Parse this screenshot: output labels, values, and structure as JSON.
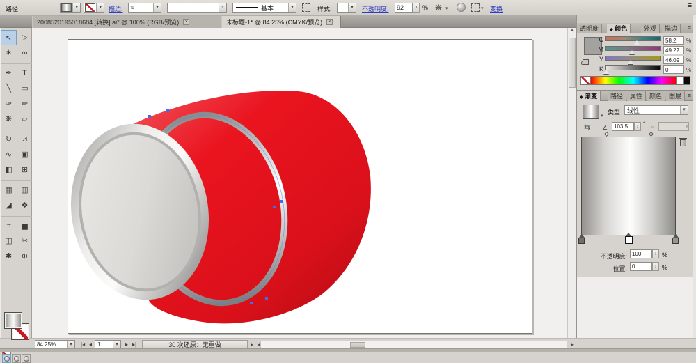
{
  "control_bar": {
    "object_label": "路径",
    "stroke_label": "描边:",
    "brush_value": "基本",
    "style_label": "样式:",
    "opacity_label": "不透明度:",
    "opacity_value": "92",
    "unit_percent": "%",
    "transform_label": "变换"
  },
  "document_tabs": [
    {
      "label": "2008520195018684 [转换].ai* @ 100% (RGB/预览)",
      "close": "×"
    },
    {
      "label": "未标题-1* @ 84.25% (CMYK/预览)",
      "close": "×"
    }
  ],
  "toolbar": {
    "tools": [
      {
        "name": "selection-tool",
        "glyph": "↖",
        "selected": true
      },
      {
        "name": "direct-selection-tool",
        "glyph": "▷",
        "selected": false
      },
      {
        "name": "magic-wand-tool",
        "glyph": "✶",
        "selected": false
      },
      {
        "name": "lasso-tool",
        "glyph": "∞",
        "selected": false
      },
      {
        "name": "pen-tool",
        "glyph": "✒",
        "selected": false
      },
      {
        "name": "type-tool",
        "glyph": "T",
        "selected": false
      },
      {
        "name": "line-tool",
        "glyph": "╲",
        "selected": false
      },
      {
        "name": "rectangle-tool",
        "glyph": "▭",
        "selected": false
      },
      {
        "name": "paintbrush-tool",
        "glyph": "✑",
        "selected": false
      },
      {
        "name": "pencil-tool",
        "glyph": "✏",
        "selected": false
      },
      {
        "name": "blob-brush-tool",
        "glyph": "❋",
        "selected": false
      },
      {
        "name": "eraser-tool",
        "glyph": "▱",
        "selected": false
      },
      {
        "name": "rotate-tool",
        "glyph": "↻",
        "selected": false
      },
      {
        "name": "scale-tool",
        "glyph": "⊿",
        "selected": false
      },
      {
        "name": "width-tool",
        "glyph": "∿",
        "selected": false
      },
      {
        "name": "free-transform-tool",
        "glyph": "▣",
        "selected": false
      },
      {
        "name": "shape-builder-tool",
        "glyph": "◧",
        "selected": false
      },
      {
        "name": "perspective-grid-tool",
        "glyph": "⊞",
        "selected": false
      },
      {
        "name": "mesh-tool",
        "glyph": "▦",
        "selected": false
      },
      {
        "name": "gradient-tool",
        "glyph": "▥",
        "selected": false
      },
      {
        "name": "eyedropper-tool",
        "glyph": "◢",
        "selected": false
      },
      {
        "name": "blend-tool",
        "glyph": "❖",
        "selected": false
      },
      {
        "name": "symbol-sprayer-tool",
        "glyph": "≈",
        "selected": false
      },
      {
        "name": "graph-tool",
        "glyph": "▅",
        "selected": false
      },
      {
        "name": "artboard-tool",
        "glyph": "◫",
        "selected": false
      },
      {
        "name": "slice-tool",
        "glyph": "✂",
        "selected": false
      },
      {
        "name": "hand-tool",
        "glyph": "✱",
        "selected": false
      },
      {
        "name": "zoom-tool",
        "glyph": "⊕",
        "selected": false
      }
    ]
  },
  "panels": {
    "color": {
      "tabs": [
        "透明度",
        "颜色",
        "外观",
        "描边"
      ],
      "active_marker": "◆",
      "menu_icon": "≡",
      "sliders": [
        {
          "label": "C",
          "value": "58.2",
          "unit": "%",
          "pos": 58
        },
        {
          "label": "M",
          "value": "49.22",
          "unit": "%",
          "pos": 49
        },
        {
          "label": "Y",
          "value": "46.09",
          "unit": "%",
          "pos": 46
        },
        {
          "label": "K",
          "value": "0",
          "unit": "%",
          "pos": 2
        }
      ]
    },
    "gradient": {
      "tabs": [
        "渐变",
        "路径",
        "属性",
        "颜色",
        "图层"
      ],
      "active_marker": "◆",
      "menu_icon": "≡",
      "type_label": "类型:",
      "type_value": "线性",
      "angle_value": "103.5",
      "degree_symbol": "°",
      "opacity_label": "不透明度:",
      "opacity_value": "100",
      "position_label": "位置:",
      "position_value": "0",
      "unit_percent": "%"
    }
  },
  "status_bar": {
    "zoom_value": "84.25%",
    "page_value": "1",
    "undo_text": "30 次还原：无重做",
    "nav_first": "|◂",
    "nav_prev": "◂",
    "nav_next": "▸",
    "nav_last": "▸|",
    "scroll_left": "◂",
    "scroll_right": "▸",
    "scroll_up": "▲"
  },
  "icons": {
    "dropdown": "▾",
    "spin_right": "›",
    "spin_up_down": "⇅",
    "recolor": "❋",
    "reverse_gradient": "⇆",
    "angle": "∠",
    "aspect": "⇔",
    "control_menu": "≣"
  },
  "colors": {
    "barrel_red": "#e8131d",
    "selection_blue": "#3f6df2",
    "link_blue": "#2f3cc0"
  }
}
